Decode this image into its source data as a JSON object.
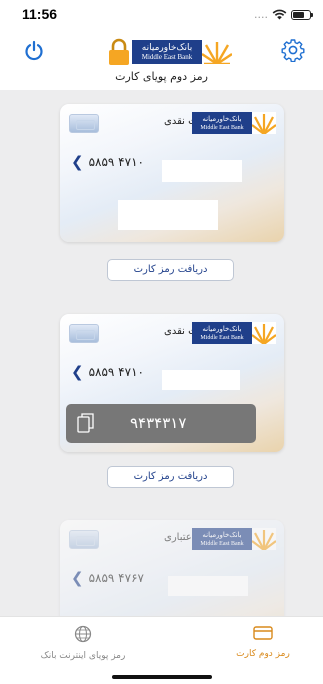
{
  "status_bar": {
    "time": "11:56",
    "signal": "....",
    "colors": {
      "bg": "#ffffff"
    }
  },
  "header": {
    "title": "رمز دوم پویای کارت",
    "logo": {
      "fa": "بانک‌خاورمیانه",
      "en": "Middle East Bank"
    },
    "icons": [
      "power-icon",
      "lock-icon",
      "gear-icon"
    ],
    "colors": {
      "power": "#1f6fd1",
      "brand_blue": "#1f3f8a",
      "brand_orange": "#f5a623"
    }
  },
  "cards": [
    {
      "type": "کارت نقدی",
      "number_visible": "۵۸۵۹ ۴۷۱۰",
      "button": "دریافت رمز کارت"
    },
    {
      "type": "کارت نقدی",
      "number_visible": "۵۸۵۹ ۴۷۱۰",
      "pin": "۹۴۳۴۳۱۷",
      "button": "دریافت رمز کارت"
    },
    {
      "type": "کارت اعتباری",
      "number_visible": "۵۸۵۹ ۴۷۶۷"
    }
  ],
  "card_logo": {
    "fa": "بانک‌خاورمیانه",
    "en": "Middle East Bank"
  },
  "tabbar": {
    "items": [
      {
        "label": "رمز دوم کارت",
        "icon": "card-icon",
        "active": true
      },
      {
        "label": "رمز پویای اینترنت بانک",
        "icon": "globe-icon",
        "active": false
      }
    ],
    "colors": {
      "active": "#d98a1c",
      "inactive": "#888888"
    }
  }
}
